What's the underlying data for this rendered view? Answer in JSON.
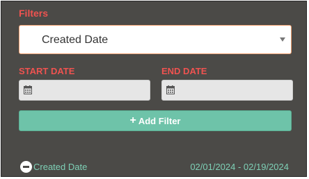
{
  "filters": {
    "title": "Filters",
    "field_select": {
      "selected": "Created Date"
    },
    "start_date": {
      "label": "START DATE",
      "value": ""
    },
    "end_date": {
      "label": "END DATE",
      "value": ""
    },
    "add_button": {
      "icon": "plus-icon",
      "label": "Add Filter"
    },
    "active": [
      {
        "name": "Created Date",
        "range": "02/01/2024 - 02/19/2024",
        "remove_icon": "minus-circle-icon"
      }
    ]
  },
  "colors": {
    "panel_bg": "#4b4a47",
    "label_red": "#ef5350",
    "accent_green": "#6ec3a9",
    "link_green": "#7ed0b6"
  }
}
